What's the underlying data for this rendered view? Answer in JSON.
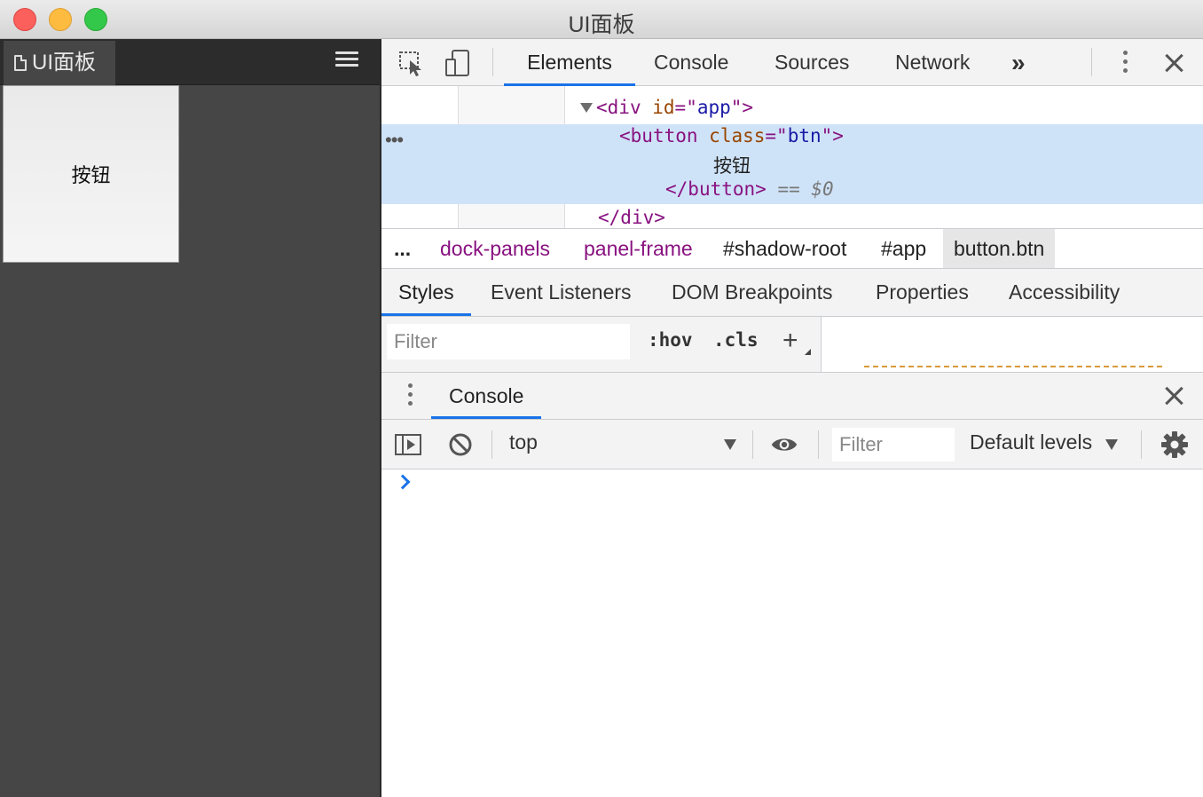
{
  "window": {
    "title": "UI面板"
  },
  "left_panel": {
    "tab_label": "UI面板",
    "button_label": "按钮"
  },
  "devtools": {
    "tabs": [
      "Elements",
      "Console",
      "Sources",
      "Network"
    ],
    "active_tab": "Elements",
    "more_tabs_label": "»",
    "dom": {
      "div_tag": "div",
      "div_attr": "id",
      "div_val": "app",
      "button_tag": "button",
      "button_attr": "class",
      "button_val": "btn",
      "button_text": "按钮",
      "close_button": "/button",
      "selected_marker": "== $0",
      "close_div": "/div"
    },
    "breadcrumbs": [
      "...",
      "dock-panels",
      "panel-frame",
      "#shadow-root",
      "#app",
      "button.btn"
    ],
    "subtabs": [
      "Styles",
      "Event Listeners",
      "DOM Breakpoints",
      "Properties",
      "Accessibility"
    ],
    "styles_filter_placeholder": "Filter",
    "hov_label": ":hov",
    "cls_label": ".cls",
    "plus_label": "+",
    "drawer_tab": "Console",
    "console": {
      "context": "top",
      "filter_placeholder": "Filter",
      "levels": "Default levels"
    },
    "accent_color": "#1a73e8"
  }
}
